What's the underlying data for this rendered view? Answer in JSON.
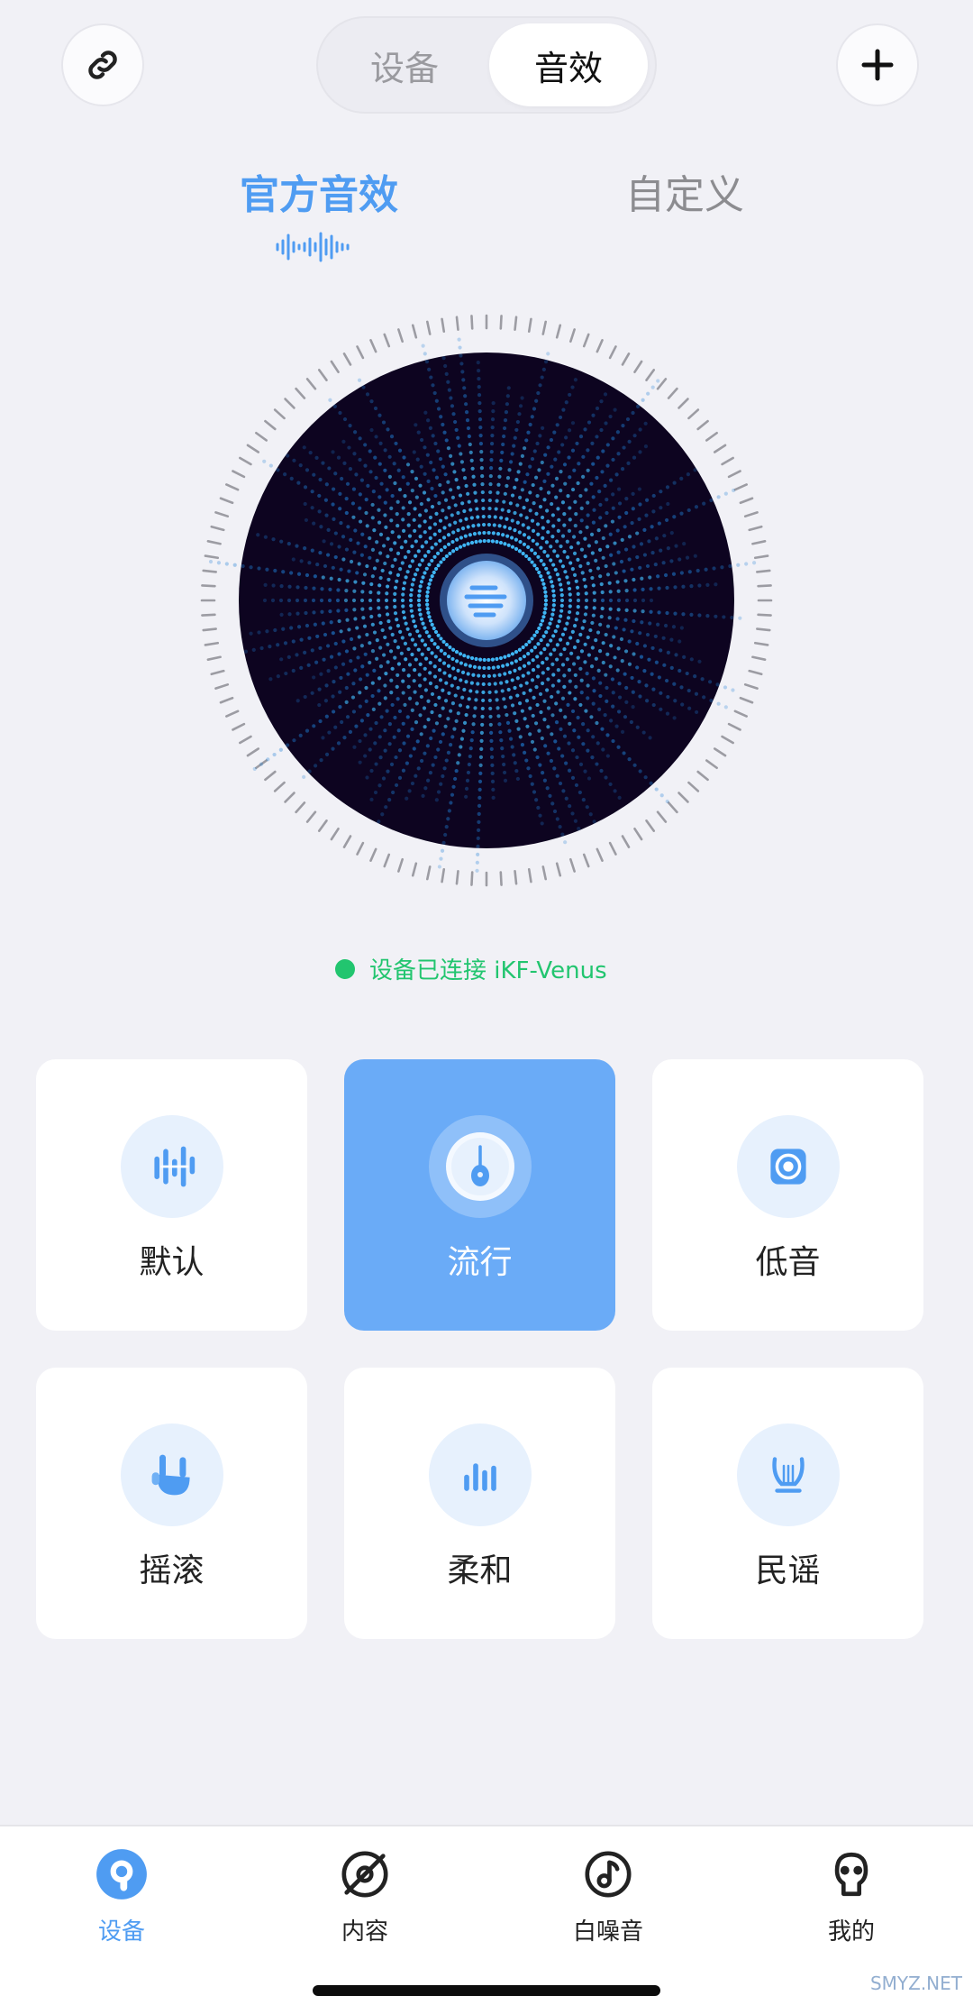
{
  "header": {
    "link_button_icon": "link-icon",
    "add_button_icon": "plus-icon",
    "segments": [
      {
        "label": "设备",
        "active": false
      },
      {
        "label": "音效",
        "active": true
      }
    ]
  },
  "subtabs": {
    "official": "官方音效",
    "custom": "自定义"
  },
  "status": {
    "text": "设备已连接 iKF-Venus",
    "color": "#22c56f"
  },
  "presets": [
    {
      "label": "默认",
      "icon": "equalizer-icon",
      "active": false
    },
    {
      "label": "流行",
      "icon": "guitar-icon",
      "active": true
    },
    {
      "label": "低音",
      "icon": "speaker-icon",
      "active": false
    },
    {
      "label": "摇滚",
      "icon": "rock-hand-icon",
      "active": false
    },
    {
      "label": "柔和",
      "icon": "bars-icon",
      "active": false
    },
    {
      "label": "民谣",
      "icon": "lyre-icon",
      "active": false
    }
  ],
  "nav": [
    {
      "label": "设备",
      "icon": "earbud-icon",
      "active": true
    },
    {
      "label": "内容",
      "icon": "disc-icon",
      "active": false
    },
    {
      "label": "白噪音",
      "icon": "music-note-icon",
      "active": false
    },
    {
      "label": "我的",
      "icon": "profile-icon",
      "active": false
    }
  ],
  "colors": {
    "accent": "#4f9cf2",
    "active_card": "#6aabf7",
    "disc": "#0d0420",
    "background": "#f1f1f6"
  },
  "watermark": "SMYZ.NET"
}
